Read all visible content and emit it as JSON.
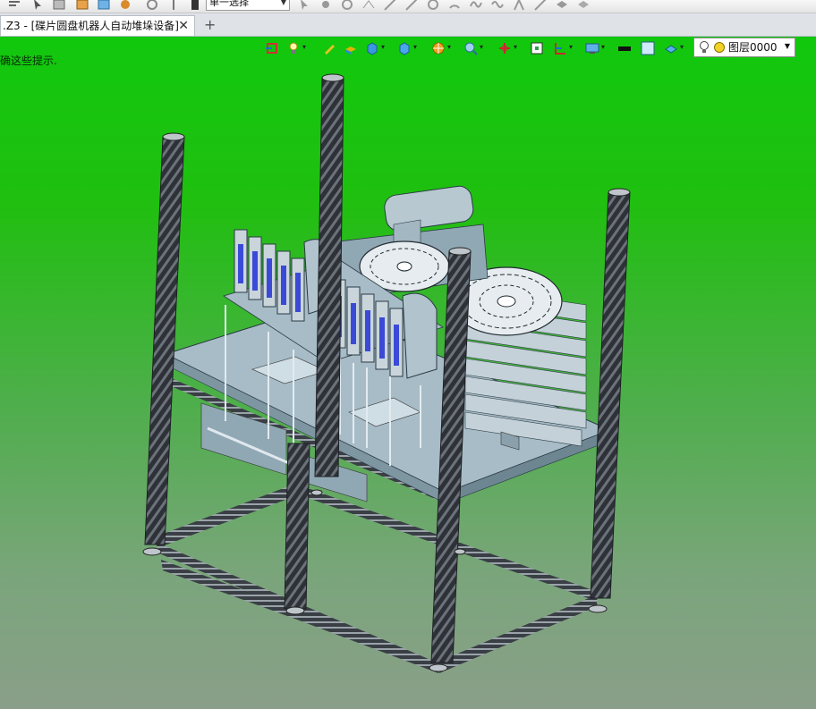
{
  "toolbar": {
    "select_mode": "单一选择",
    "icons": [
      "menu-icon",
      "cursor-icon",
      "list-icon",
      "import-icon",
      "export-icon",
      "camera-icon",
      "rotate-icon",
      "pin-icon",
      "bookmark-icon",
      "pick-filter-icon",
      "point-icon",
      "record-icon",
      "vertex-icon",
      "line-icon",
      "curve-icon",
      "circle-icon",
      "arc-icon",
      "spline-icon",
      "wave-icon",
      "snap-icon",
      "eye-icon",
      "layer-stack-icon"
    ]
  },
  "tab": {
    "title": ".Z3 - [碟片圆盘机器人自动堆垛设备]",
    "close_symbol": "✕",
    "new_tab_symbol": "+"
  },
  "viewport": {
    "hint_text": "确这些提示.",
    "background_top": "#11c80d",
    "background_bottom": "#8a9f89",
    "view_tools": [
      "view-fit-icon",
      "light-icon",
      "pen-icon",
      "solid-icon",
      "cube-icon",
      "cube-view-icon",
      "section-icon",
      "measure-icon",
      "axis-icon",
      "frame-icon",
      "grid-icon",
      "display-icon",
      "color-black-swatch",
      "color-white-swatch",
      "shade-icon"
    ],
    "layer": {
      "name": "图层0000",
      "color": "#f2d227"
    }
  },
  "model": {
    "frame_color": "#2e3238",
    "plate_color": "#a7bcc7",
    "disc_color": "#c4d1d8"
  }
}
